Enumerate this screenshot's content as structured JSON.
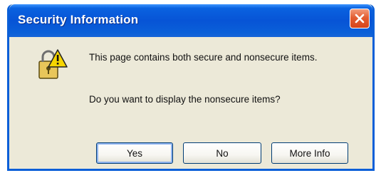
{
  "dialog": {
    "title": "Security Information",
    "message": "This page contains both secure and nonsecure items.",
    "question": "Do you want to display the nonsecure items?",
    "icon": "security-warning-icon"
  },
  "buttons": {
    "yes": "Yes",
    "no": "No",
    "more_info": "More Info"
  },
  "colors": {
    "titlebar": "#0a5fd8",
    "body": "#ece9d8",
    "close": "#e35d32"
  }
}
